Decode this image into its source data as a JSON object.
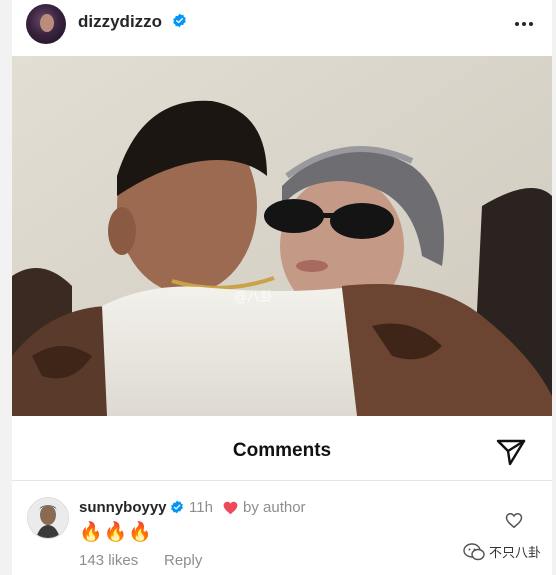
{
  "post": {
    "username": "dizzydizzo",
    "watermark": "@八卦"
  },
  "comments_panel": {
    "title": "Comments"
  },
  "comment": {
    "username": "sunnyboyyy",
    "time": "11h",
    "by_author": "by author",
    "text": "🔥🔥🔥",
    "likes": "143 likes",
    "reply": "Reply"
  },
  "brand": {
    "label": "不只八卦"
  },
  "colors": {
    "verified": "#0095f6",
    "heart": "#ed4956",
    "muted": "#8e8e8e"
  }
}
